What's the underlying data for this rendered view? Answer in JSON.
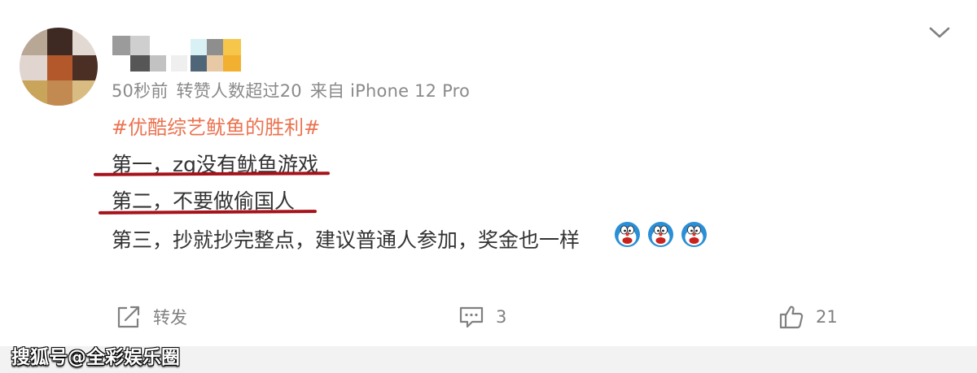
{
  "post": {
    "meta": {
      "time": "50秒前",
      "reposts": "转赞人数超过20",
      "source": "来自 iPhone 12 Pro"
    },
    "hashtag": "#优酷综艺鱿鱼的胜利#",
    "lines": [
      "第一，zg没有鱿鱼游戏",
      "第二，不要做偷国人",
      "第三，抄就抄完整点，建议普通人参加，奖金也一样"
    ],
    "emoji": [
      "doraemon-emoji",
      "doraemon-emoji",
      "doraemon-emoji"
    ]
  },
  "actions": {
    "repost_label": "转发",
    "comment_count": "3",
    "like_count": "21"
  },
  "watermark": "搜狐号@全彩娱乐圈",
  "colors": {
    "hashtag": "#eb7350",
    "underline": "#a5121a",
    "meta": "#8a8a8a"
  }
}
